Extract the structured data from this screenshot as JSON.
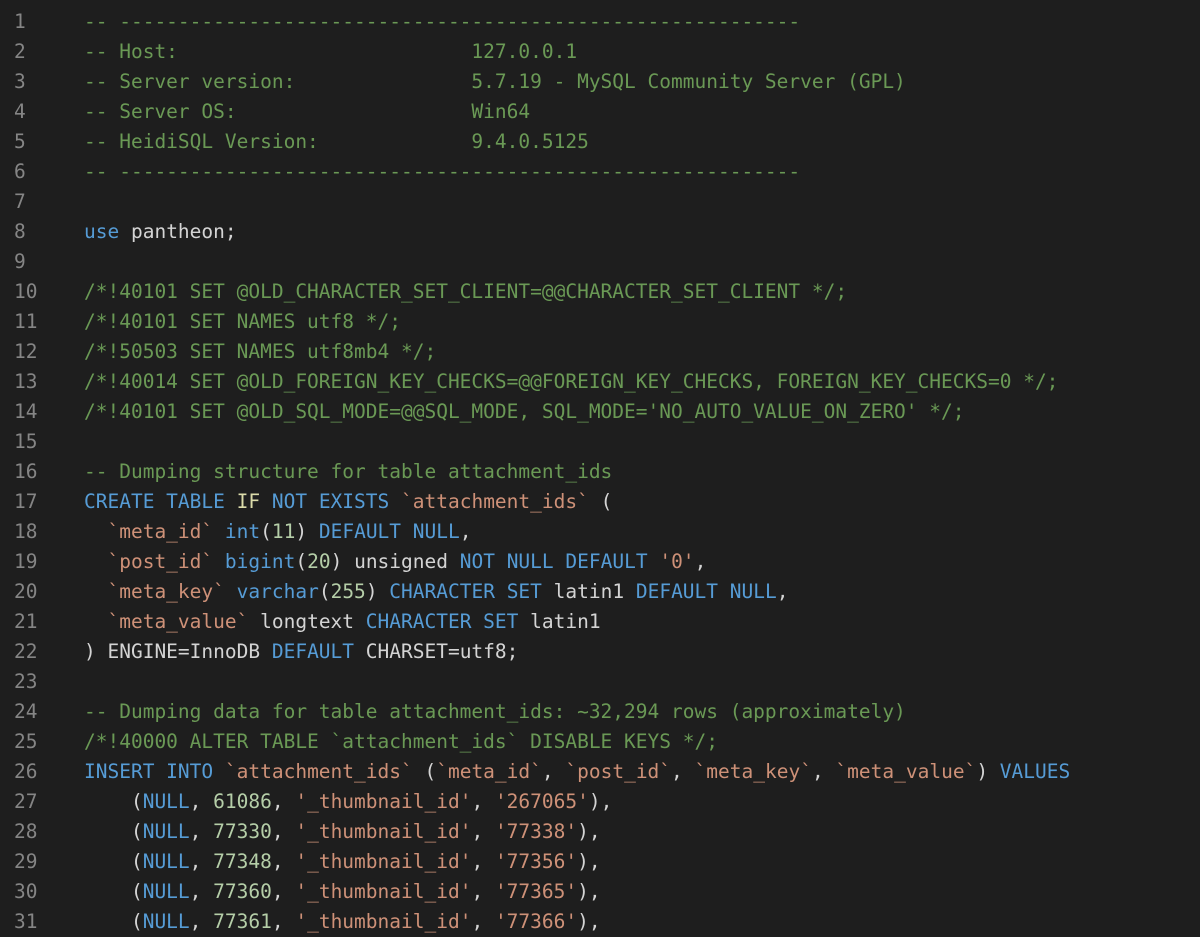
{
  "editor": {
    "colors": {
      "background": "#1e1e1e",
      "line_number": "#858585",
      "default": "#d4d4d4",
      "comment": "#6a9955",
      "keyword": "#569cd6",
      "string": "#ce9178",
      "number": "#b5cea8",
      "function": "#dcdcaa"
    },
    "lines": [
      {
        "n": "1",
        "tokens": [
          {
            "t": "-- ----------------------------------------------------------",
            "c": "c"
          }
        ]
      },
      {
        "n": "2",
        "tokens": [
          {
            "t": "-- Host:                         127.0.0.1",
            "c": "c"
          }
        ]
      },
      {
        "n": "3",
        "tokens": [
          {
            "t": "-- Server version:               5.7.19 - MySQL Community Server (GPL)",
            "c": "c"
          }
        ]
      },
      {
        "n": "4",
        "tokens": [
          {
            "t": "-- Server OS:                    Win64",
            "c": "c"
          }
        ]
      },
      {
        "n": "5",
        "tokens": [
          {
            "t": "-- HeidiSQL Version:             9.4.0.5125",
            "c": "c"
          }
        ]
      },
      {
        "n": "6",
        "tokens": [
          {
            "t": "-- ----------------------------------------------------------",
            "c": "c"
          }
        ]
      },
      {
        "n": "7",
        "tokens": []
      },
      {
        "n": "8",
        "tokens": [
          {
            "t": "use",
            "c": "k"
          },
          {
            "t": " pantheon;",
            "c": "p"
          }
        ]
      },
      {
        "n": "9",
        "tokens": []
      },
      {
        "n": "10",
        "tokens": [
          {
            "t": "/*!40101 SET @OLD_CHARACTER_SET_CLIENT=@@CHARACTER_SET_CLIENT */;",
            "c": "c"
          }
        ]
      },
      {
        "n": "11",
        "tokens": [
          {
            "t": "/*!40101 SET NAMES utf8 */;",
            "c": "c"
          }
        ]
      },
      {
        "n": "12",
        "tokens": [
          {
            "t": "/*!50503 SET NAMES utf8mb4 */;",
            "c": "c"
          }
        ]
      },
      {
        "n": "13",
        "tokens": [
          {
            "t": "/*!40014 SET @OLD_FOREIGN_KEY_CHECKS=@@FOREIGN_KEY_CHECKS, FOREIGN_KEY_CHECKS=0 */;",
            "c": "c"
          }
        ]
      },
      {
        "n": "14",
        "tokens": [
          {
            "t": "/*!40101 SET @OLD_SQL_MODE=@@SQL_MODE, SQL_MODE='NO_AUTO_VALUE_ON_ZERO' */;",
            "c": "c"
          }
        ]
      },
      {
        "n": "15",
        "tokens": []
      },
      {
        "n": "16",
        "tokens": [
          {
            "t": "-- Dumping structure for table attachment_ids",
            "c": "c"
          }
        ]
      },
      {
        "n": "17",
        "tokens": [
          {
            "t": "CREATE TABLE ",
            "c": "k"
          },
          {
            "t": "IF",
            "c": "f"
          },
          {
            "t": " ",
            "c": "p"
          },
          {
            "t": "NOT EXISTS",
            "c": "k"
          },
          {
            "t": " ",
            "c": "p"
          },
          {
            "t": "`attachment_ids`",
            "c": "s"
          },
          {
            "t": " (",
            "c": "p"
          }
        ]
      },
      {
        "n": "18",
        "tokens": [
          {
            "t": "  ",
            "c": "p"
          },
          {
            "t": "`meta_id`",
            "c": "s"
          },
          {
            "t": " ",
            "c": "p"
          },
          {
            "t": "int",
            "c": "k"
          },
          {
            "t": "(",
            "c": "p"
          },
          {
            "t": "11",
            "c": "n"
          },
          {
            "t": ") ",
            "c": "p"
          },
          {
            "t": "DEFAULT NULL",
            "c": "k"
          },
          {
            "t": ",",
            "c": "p"
          }
        ]
      },
      {
        "n": "19",
        "tokens": [
          {
            "t": "  ",
            "c": "p"
          },
          {
            "t": "`post_id`",
            "c": "s"
          },
          {
            "t": " ",
            "c": "p"
          },
          {
            "t": "bigint",
            "c": "k"
          },
          {
            "t": "(",
            "c": "p"
          },
          {
            "t": "20",
            "c": "n"
          },
          {
            "t": ") unsigned ",
            "c": "p"
          },
          {
            "t": "NOT NULL DEFAULT",
            "c": "k"
          },
          {
            "t": " ",
            "c": "p"
          },
          {
            "t": "'0'",
            "c": "s"
          },
          {
            "t": ",",
            "c": "p"
          }
        ]
      },
      {
        "n": "20",
        "tokens": [
          {
            "t": "  ",
            "c": "p"
          },
          {
            "t": "`meta_key`",
            "c": "s"
          },
          {
            "t": " ",
            "c": "p"
          },
          {
            "t": "varchar",
            "c": "k"
          },
          {
            "t": "(",
            "c": "p"
          },
          {
            "t": "255",
            "c": "n"
          },
          {
            "t": ") ",
            "c": "p"
          },
          {
            "t": "CHARACTER SET",
            "c": "k"
          },
          {
            "t": " latin1 ",
            "c": "p"
          },
          {
            "t": "DEFAULT NULL",
            "c": "k"
          },
          {
            "t": ",",
            "c": "p"
          }
        ]
      },
      {
        "n": "21",
        "tokens": [
          {
            "t": "  ",
            "c": "p"
          },
          {
            "t": "`meta_value`",
            "c": "s"
          },
          {
            "t": " longtext ",
            "c": "p"
          },
          {
            "t": "CHARACTER SET",
            "c": "k"
          },
          {
            "t": " latin1",
            "c": "p"
          }
        ]
      },
      {
        "n": "22",
        "tokens": [
          {
            "t": ") ENGINE=InnoDB ",
            "c": "p"
          },
          {
            "t": "DEFAULT",
            "c": "k"
          },
          {
            "t": " CHARSET=utf8;",
            "c": "p"
          }
        ]
      },
      {
        "n": "23",
        "tokens": []
      },
      {
        "n": "24",
        "tokens": [
          {
            "t": "-- Dumping data for table attachment_ids: ~32,294 rows (approximately)",
            "c": "c"
          }
        ]
      },
      {
        "n": "25",
        "tokens": [
          {
            "t": "/*!40000 ALTER TABLE `attachment_ids` DISABLE KEYS */;",
            "c": "c"
          }
        ]
      },
      {
        "n": "26",
        "tokens": [
          {
            "t": "INSERT INTO",
            "c": "k"
          },
          {
            "t": " ",
            "c": "p"
          },
          {
            "t": "`attachment_ids`",
            "c": "s"
          },
          {
            "t": " (",
            "c": "p"
          },
          {
            "t": "`meta_id`",
            "c": "s"
          },
          {
            "t": ", ",
            "c": "p"
          },
          {
            "t": "`post_id`",
            "c": "s"
          },
          {
            "t": ", ",
            "c": "p"
          },
          {
            "t": "`meta_key`",
            "c": "s"
          },
          {
            "t": ", ",
            "c": "p"
          },
          {
            "t": "`meta_value`",
            "c": "s"
          },
          {
            "t": ") ",
            "c": "p"
          },
          {
            "t": "VALUES",
            "c": "k"
          }
        ]
      },
      {
        "n": "27",
        "tokens": [
          {
            "t": "    (",
            "c": "p"
          },
          {
            "t": "NULL",
            "c": "k"
          },
          {
            "t": ", ",
            "c": "p"
          },
          {
            "t": "61086",
            "c": "n"
          },
          {
            "t": ", ",
            "c": "p"
          },
          {
            "t": "'_thumbnail_id'",
            "c": "s"
          },
          {
            "t": ", ",
            "c": "p"
          },
          {
            "t": "'267065'",
            "c": "s"
          },
          {
            "t": "),",
            "c": "p"
          }
        ]
      },
      {
        "n": "28",
        "tokens": [
          {
            "t": "    (",
            "c": "p"
          },
          {
            "t": "NULL",
            "c": "k"
          },
          {
            "t": ", ",
            "c": "p"
          },
          {
            "t": "77330",
            "c": "n"
          },
          {
            "t": ", ",
            "c": "p"
          },
          {
            "t": "'_thumbnail_id'",
            "c": "s"
          },
          {
            "t": ", ",
            "c": "p"
          },
          {
            "t": "'77338'",
            "c": "s"
          },
          {
            "t": "),",
            "c": "p"
          }
        ]
      },
      {
        "n": "29",
        "tokens": [
          {
            "t": "    (",
            "c": "p"
          },
          {
            "t": "NULL",
            "c": "k"
          },
          {
            "t": ", ",
            "c": "p"
          },
          {
            "t": "77348",
            "c": "n"
          },
          {
            "t": ", ",
            "c": "p"
          },
          {
            "t": "'_thumbnail_id'",
            "c": "s"
          },
          {
            "t": ", ",
            "c": "p"
          },
          {
            "t": "'77356'",
            "c": "s"
          },
          {
            "t": "),",
            "c": "p"
          }
        ]
      },
      {
        "n": "30",
        "tokens": [
          {
            "t": "    (",
            "c": "p"
          },
          {
            "t": "NULL",
            "c": "k"
          },
          {
            "t": ", ",
            "c": "p"
          },
          {
            "t": "77360",
            "c": "n"
          },
          {
            "t": ", ",
            "c": "p"
          },
          {
            "t": "'_thumbnail_id'",
            "c": "s"
          },
          {
            "t": ", ",
            "c": "p"
          },
          {
            "t": "'77365'",
            "c": "s"
          },
          {
            "t": "),",
            "c": "p"
          }
        ]
      },
      {
        "n": "31",
        "tokens": [
          {
            "t": "    (",
            "c": "p"
          },
          {
            "t": "NULL",
            "c": "k"
          },
          {
            "t": ", ",
            "c": "p"
          },
          {
            "t": "77361",
            "c": "n"
          },
          {
            "t": ", ",
            "c": "p"
          },
          {
            "t": "'_thumbnail_id'",
            "c": "s"
          },
          {
            "t": ", ",
            "c": "p"
          },
          {
            "t": "'77366'",
            "c": "s"
          },
          {
            "t": "),",
            "c": "p"
          }
        ]
      }
    ]
  }
}
